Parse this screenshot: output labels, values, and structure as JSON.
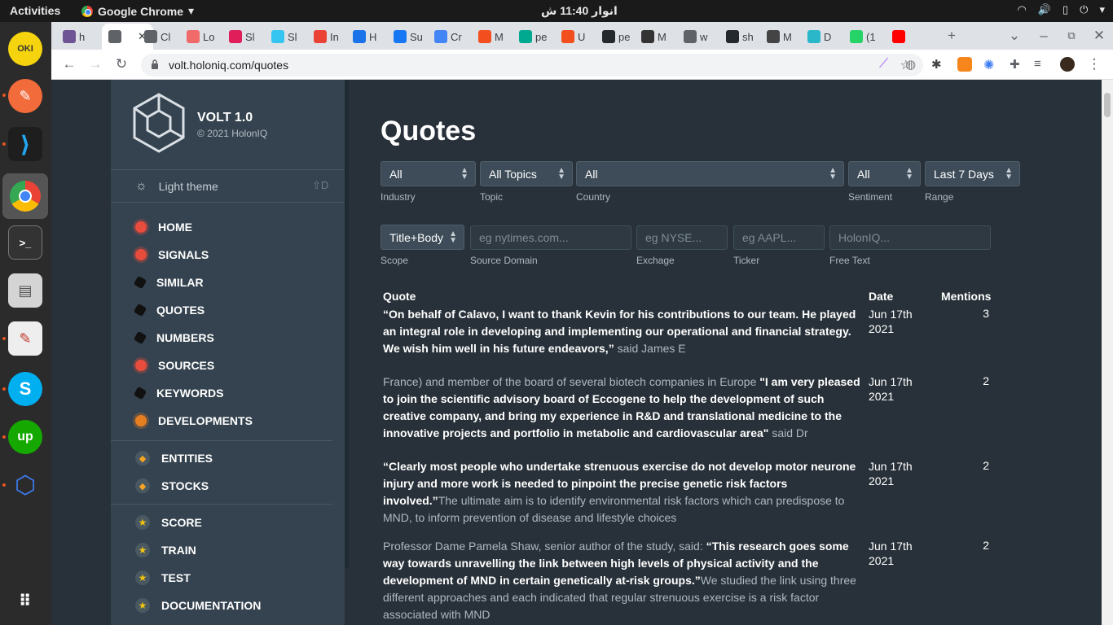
{
  "topbar": {
    "activities": "Activities",
    "app_name": "Google Chrome",
    "clock": "انوار 11:40 ش"
  },
  "browser": {
    "url": "volt.holoniq.com/quotes",
    "tabs": [
      {
        "label": "h",
        "color": "#6e5494"
      },
      {
        "label": "",
        "color": "#5f6368",
        "active": true
      },
      {
        "label": "Cl",
        "color": "#5f6368"
      },
      {
        "label": "Lo",
        "color": "#f06a6a"
      },
      {
        "label": "Sl",
        "color": "#e01e5a"
      },
      {
        "label": "Sl",
        "color": "#36c5f0"
      },
      {
        "label": "In",
        "color": "#ea4335"
      },
      {
        "label": "H",
        "color": "#1a73e8"
      },
      {
        "label": "Su",
        "color": "#1877f2"
      },
      {
        "label": "Cr",
        "color": "#4285f4"
      },
      {
        "label": "M",
        "color": "#f24e1e"
      },
      {
        "label": "pe",
        "color": "#00a98f"
      },
      {
        "label": "U",
        "color": "#f24e1e"
      },
      {
        "label": "pe",
        "color": "#24292e"
      },
      {
        "label": "M",
        "color": "#333333"
      },
      {
        "label": "w",
        "color": "#5f6368"
      },
      {
        "label": "sh",
        "color": "#24292e"
      },
      {
        "label": "M",
        "color": "#444444"
      },
      {
        "label": "D",
        "color": "#2ab7ca"
      },
      {
        "label": "(1",
        "color": "#25d366"
      },
      {
        "label": "",
        "color": "#ff0000"
      }
    ]
  },
  "sidebar": {
    "brand_title": "VOLT 1.0",
    "brand_sub": "© 2021 HolonIQ",
    "theme_label": "Light theme",
    "theme_shortcut": "D",
    "nav_group1": [
      {
        "label": "HOME",
        "kind": "red"
      },
      {
        "label": "SIGNALS",
        "kind": "red"
      },
      {
        "label": "SIMILAR",
        "kind": "black"
      },
      {
        "label": "QUOTES",
        "kind": "black"
      },
      {
        "label": "NUMBERS",
        "kind": "black"
      },
      {
        "label": "SOURCES",
        "kind": "red"
      },
      {
        "label": "KEYWORDS",
        "kind": "black"
      },
      {
        "label": "DEVELOPMENTS",
        "kind": "orange"
      }
    ],
    "nav_group2": [
      {
        "label": "ENTITIES"
      },
      {
        "label": "STOCKS"
      }
    ],
    "nav_group3": [
      {
        "label": "SCORE"
      },
      {
        "label": "TRAIN"
      },
      {
        "label": "TEST"
      },
      {
        "label": "DOCUMENTATION"
      }
    ]
  },
  "main": {
    "title": "Quotes",
    "filters": {
      "industry": {
        "value": "All",
        "label": "Industry"
      },
      "topic": {
        "value": "All Topics",
        "label": "Topic"
      },
      "country": {
        "value": "All",
        "label": "Country"
      },
      "sentiment": {
        "value": "All",
        "label": "Sentiment"
      },
      "range": {
        "value": "Last 7 Days",
        "label": "Range"
      },
      "scope": {
        "value": "Title+Body",
        "label": "Scope"
      },
      "source_domain": {
        "placeholder": "eg nytimes.com...",
        "label": "Source Domain"
      },
      "exchange": {
        "placeholder": "eg NYSE...",
        "label": "Exchage"
      },
      "ticker": {
        "placeholder": "eg AAPL...",
        "label": "Ticker"
      },
      "free_text": {
        "placeholder": "HolonIQ...",
        "label": "Free Text"
      }
    },
    "table": {
      "headers": {
        "quote": "Quote",
        "date": "Date",
        "mentions": "Mentions"
      },
      "rows": [
        {
          "pre": "",
          "bold": "“On behalf of Calavo, I want to thank Kevin for his contributions to our team. He played an integral role in developing and implementing our operational and financial strategy. We wish him well in his future endeavors,”",
          "post": " said James E",
          "date_line1": "Jun 17th",
          "date_line2": "2021",
          "mentions": "3"
        },
        {
          "pre": "France) and member of the board of several biotech companies in Europe ",
          "bold": "\"I am very pleased to join the scientific advisory board of Eccogene to help the development of such creative company, and bring my experience in R&D and translational medicine to the innovative projects and portfolio in metabolic and cardiovascular area\"",
          "post": " said Dr",
          "date_line1": "Jun 17th",
          "date_line2": "2021",
          "mentions": "2"
        },
        {
          "pre": "",
          "bold": "“Clearly most people who undertake strenuous exercise do not develop motor neurone injury and more work is needed to pinpoint the precise genetic risk factors involved.”",
          "post": "The ultimate aim is to identify environmental risk factors which can predispose to MND, to inform prevention of disease and lifestyle choices",
          "date_line1": "Jun 17th",
          "date_line2": "2021",
          "mentions": "2"
        },
        {
          "pre": "Professor Dame Pamela Shaw, senior author of the study, said: ",
          "bold": "“This research goes some way towards unravelling the link between high levels of physical activity and the development of MND in certain genetically at-risk groups.”",
          "post": "We studied the link using three different approaches and each indicated that regular strenuous exercise is a risk factor associated with MND",
          "date_line1": "Jun 17th",
          "date_line2": "2021",
          "mentions": "2"
        }
      ]
    }
  }
}
